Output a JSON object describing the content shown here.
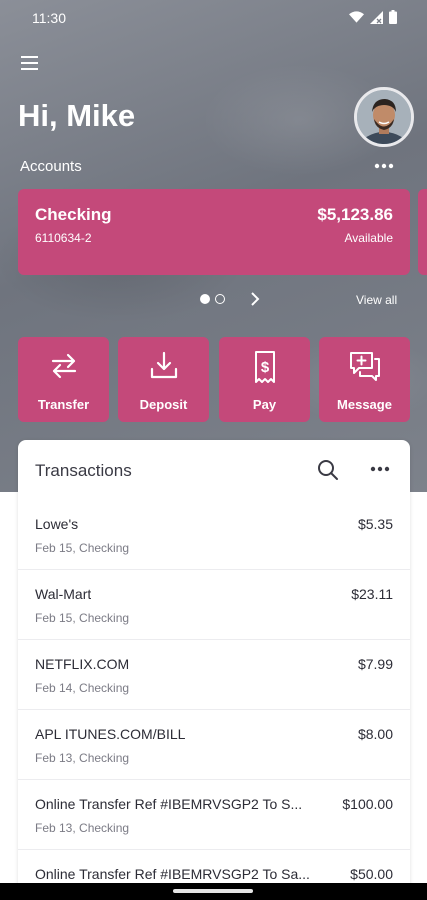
{
  "status_bar": {
    "time": "11:30"
  },
  "header": {
    "greeting": "Hi, Mike"
  },
  "accounts": {
    "label": "Accounts",
    "card": {
      "name": "Checking",
      "number": "6110634-2",
      "balance": "$5,123.86",
      "balance_label": "Available"
    },
    "view_all": "View all"
  },
  "actions": [
    {
      "label": "Transfer",
      "icon": "transfer-icon"
    },
    {
      "label": "Deposit",
      "icon": "deposit-icon"
    },
    {
      "label": "Pay",
      "icon": "bill-icon"
    },
    {
      "label": "Message",
      "icon": "message-icon"
    }
  ],
  "transactions": {
    "title": "Transactions",
    "items": [
      {
        "description": "Lowe's",
        "meta": "Feb 15, Checking",
        "amount": "$5.35"
      },
      {
        "description": "Wal-Mart",
        "meta": "Feb 15, Checking",
        "amount": "$23.11"
      },
      {
        "description": "NETFLIX.COM",
        "meta": "Feb 14, Checking",
        "amount": "$7.99"
      },
      {
        "description": "APL ITUNES.COM/BILL",
        "meta": "Feb 13, Checking",
        "amount": "$8.00"
      },
      {
        "description": "Online Transfer Ref #IBEMRVSGP2 To S...",
        "meta": "Feb 13, Checking",
        "amount": "$100.00"
      },
      {
        "description": "Online Transfer Ref #IBEMRVSGP2 To Sa...",
        "meta": "",
        "amount": "$50.00"
      }
    ]
  },
  "colors": {
    "accent": "#c4497a",
    "hero_background": "#7a7f88",
    "text_primary": "#2c2c36",
    "text_secondary": "#7b7b85"
  }
}
